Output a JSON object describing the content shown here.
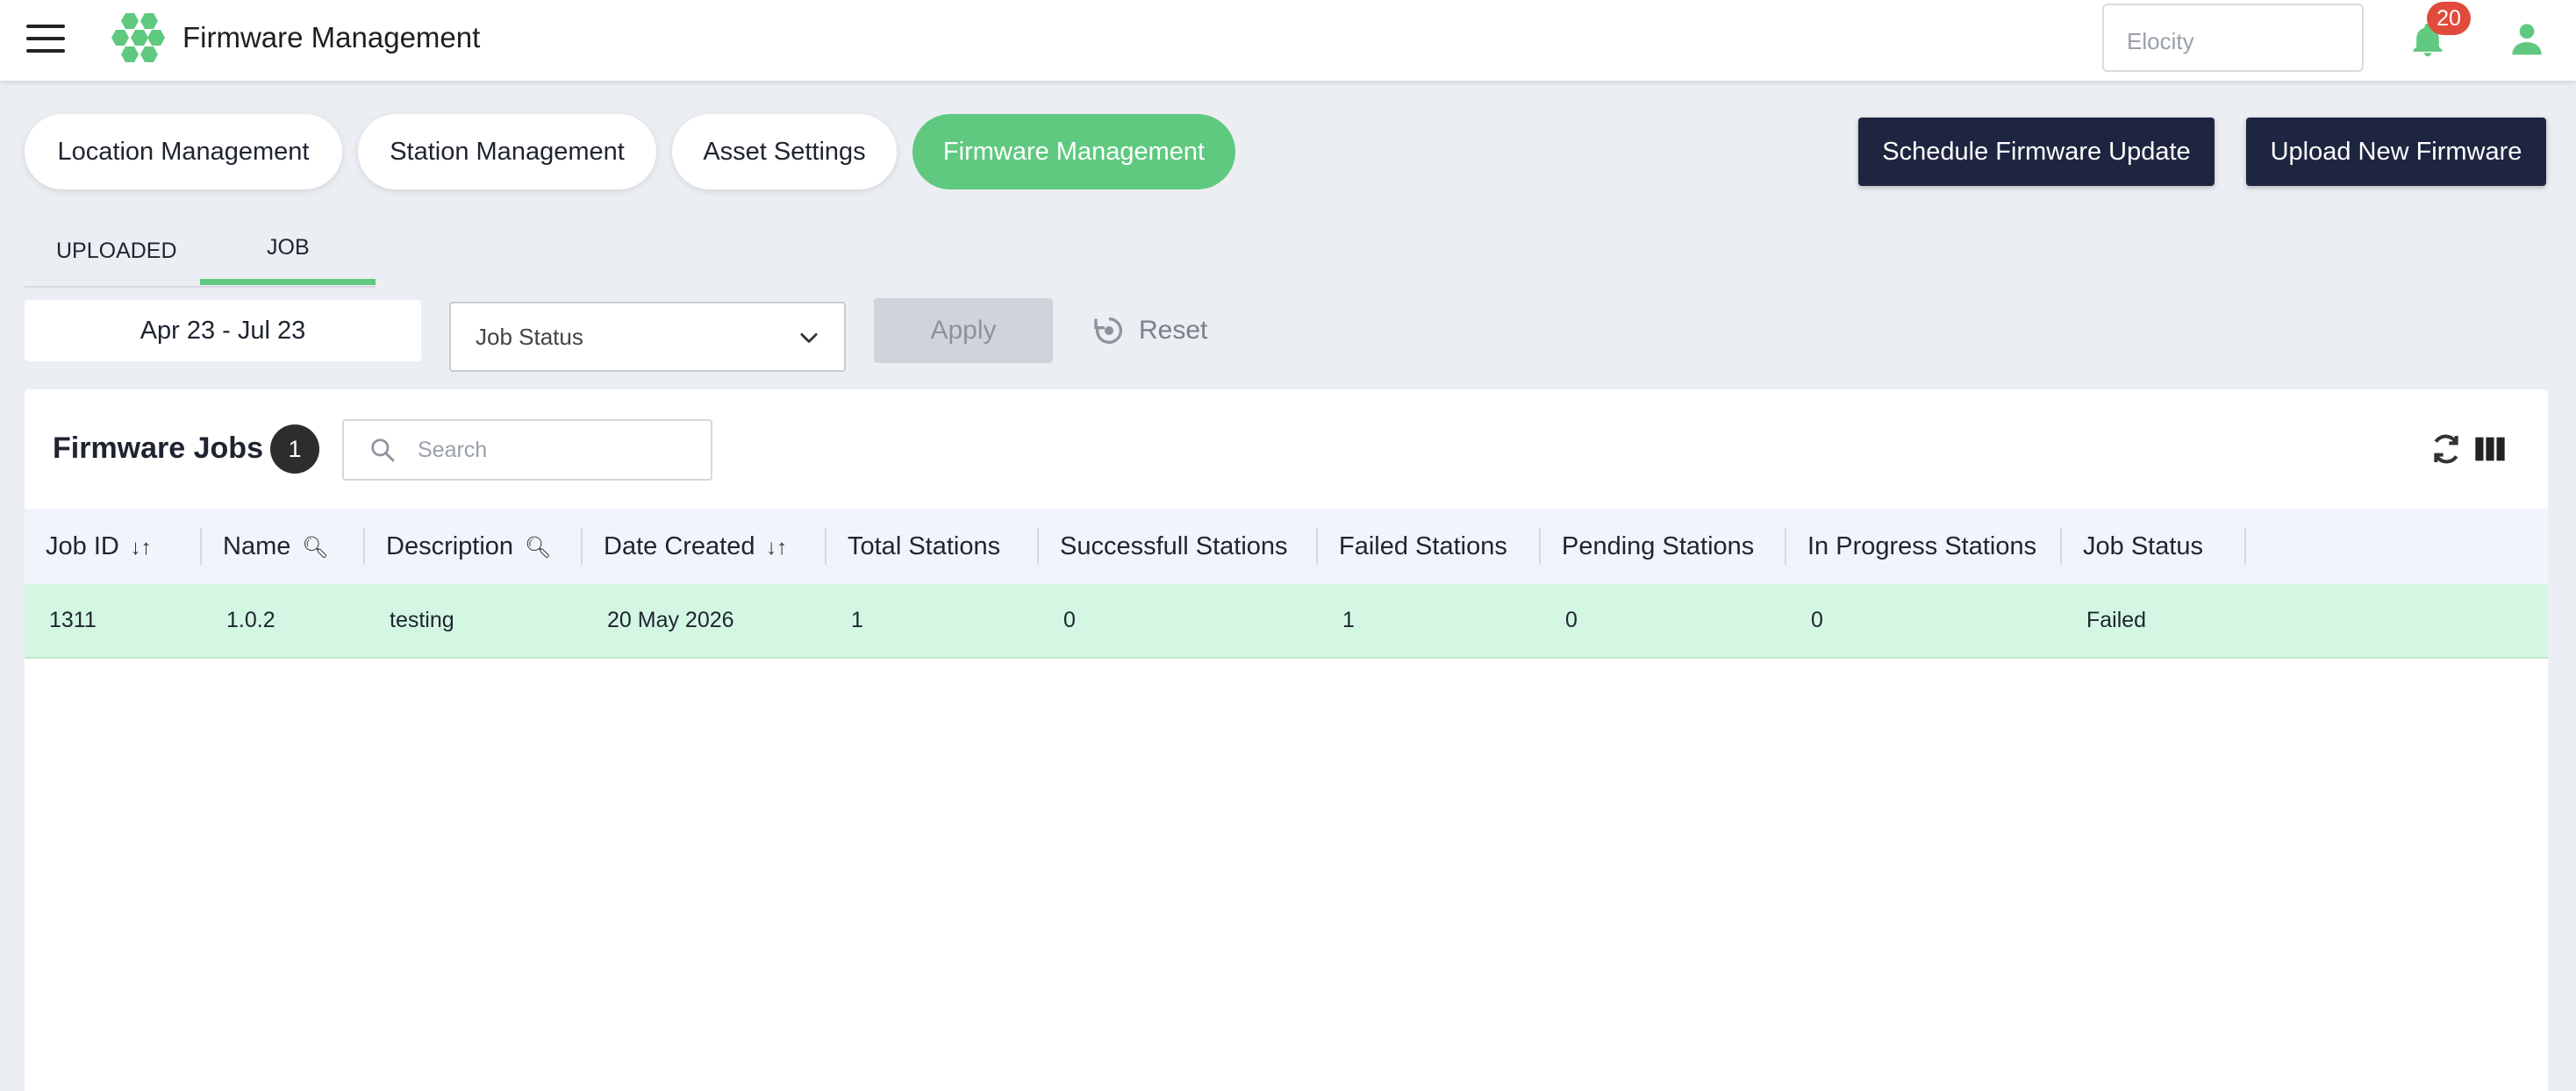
{
  "app": {
    "title": "Firmware Management"
  },
  "header": {
    "org_placeholder": "Elocity",
    "notifications_count": "20"
  },
  "module_tabs": [
    {
      "label": "Location Management",
      "active": false
    },
    {
      "label": "Station Management",
      "active": false
    },
    {
      "label": "Asset Settings",
      "active": false
    },
    {
      "label": "Firmware Management",
      "active": true
    }
  ],
  "actions": {
    "schedule_label": "Schedule Firmware Update",
    "upload_label": "Upload New Firmware"
  },
  "sub_tabs": [
    {
      "label": "UPLOADED",
      "active": false
    },
    {
      "label": "JOB",
      "active": true
    }
  ],
  "filters": {
    "date_range": "Apr 23 - Jul 23",
    "job_status_placeholder": "Job Status",
    "apply_label": "Apply",
    "reset_label": "Reset"
  },
  "jobs_panel": {
    "title": "Firmware Jobs",
    "count": "1",
    "search_placeholder": "Search",
    "columns": [
      {
        "label": "Job ID",
        "icon": "sort-icon"
      },
      {
        "label": "Name",
        "icon": "search-icon"
      },
      {
        "label": "Description",
        "icon": "search-icon"
      },
      {
        "label": "Date Created",
        "icon": "sort-icon"
      },
      {
        "label": "Total Stations"
      },
      {
        "label": "Successfull Stations"
      },
      {
        "label": "Failed Stations"
      },
      {
        "label": "Pending Stations"
      },
      {
        "label": "In Progress Stations"
      },
      {
        "label": "Job Status"
      }
    ],
    "rows": [
      [
        "1311",
        "1.0.2",
        "testing",
        "20 May 2026",
        "1",
        "0",
        "1",
        "0",
        "0",
        "Failed"
      ]
    ]
  },
  "colors": {
    "accent_green": "#5fc97f",
    "dark_button": "#1e2540",
    "row_highlight": "#d3f7e3",
    "badge_red": "#e04b3c"
  }
}
